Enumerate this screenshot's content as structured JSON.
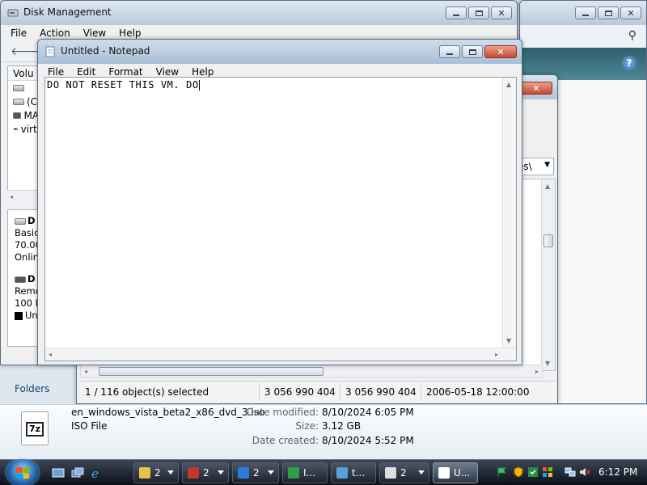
{
  "disk_management": {
    "title": "Disk Management",
    "menu": [
      "File",
      "Action",
      "View",
      "Help"
    ],
    "volume_header": "Volu",
    "volumes": [
      "",
      "(C",
      "MA",
      "virt"
    ],
    "disks": [
      {
        "name": "D",
        "lines": [
          "Basic",
          "70.00",
          "Onlin"
        ]
      },
      {
        "name": "D",
        "lines": [
          "Remo",
          "100 M"
        ],
        "legend": "Una"
      }
    ]
  },
  "explorer": {
    "address_fragment": "es\\",
    "status": {
      "selection": "1 / 116 object(s) selected",
      "size1": "3 056 990 404",
      "size2": "3 056 990 404",
      "date": "2006-05-18 12:00:00"
    },
    "folders_label": "Folders"
  },
  "notepad": {
    "title": "Untitled - Notepad",
    "menu": [
      "File",
      "Edit",
      "Format",
      "View",
      "Help"
    ],
    "text": "DO NOT RESET THIS VM. DO"
  },
  "details": {
    "file_name": "en_windows_vista_beta2_x86_dvd_3.iso",
    "file_type": "ISO File",
    "icon_label": "7z",
    "date_modified_label": "Date modified:",
    "date_modified": "8/10/2024 6:05 PM",
    "size_label": "Size:",
    "size": "3.12 GB",
    "date_created_label": "Date created:",
    "date_created": "8/10/2024 5:52 PM"
  },
  "taskbar": {
    "tasks": [
      {
        "label": "2",
        "color": "#e8c34a"
      },
      {
        "label": "2",
        "color": "#c0392b"
      },
      {
        "label": "2",
        "color": "#2b7bd6"
      },
      {
        "label": "I...",
        "color": "#2e9e4a"
      },
      {
        "label": "t...",
        "color": "#5aa0d8"
      },
      {
        "label": "2",
        "color": "#dddddd"
      },
      {
        "label": "U...",
        "color": "#ffffff"
      }
    ],
    "clock": "6:12 PM"
  }
}
